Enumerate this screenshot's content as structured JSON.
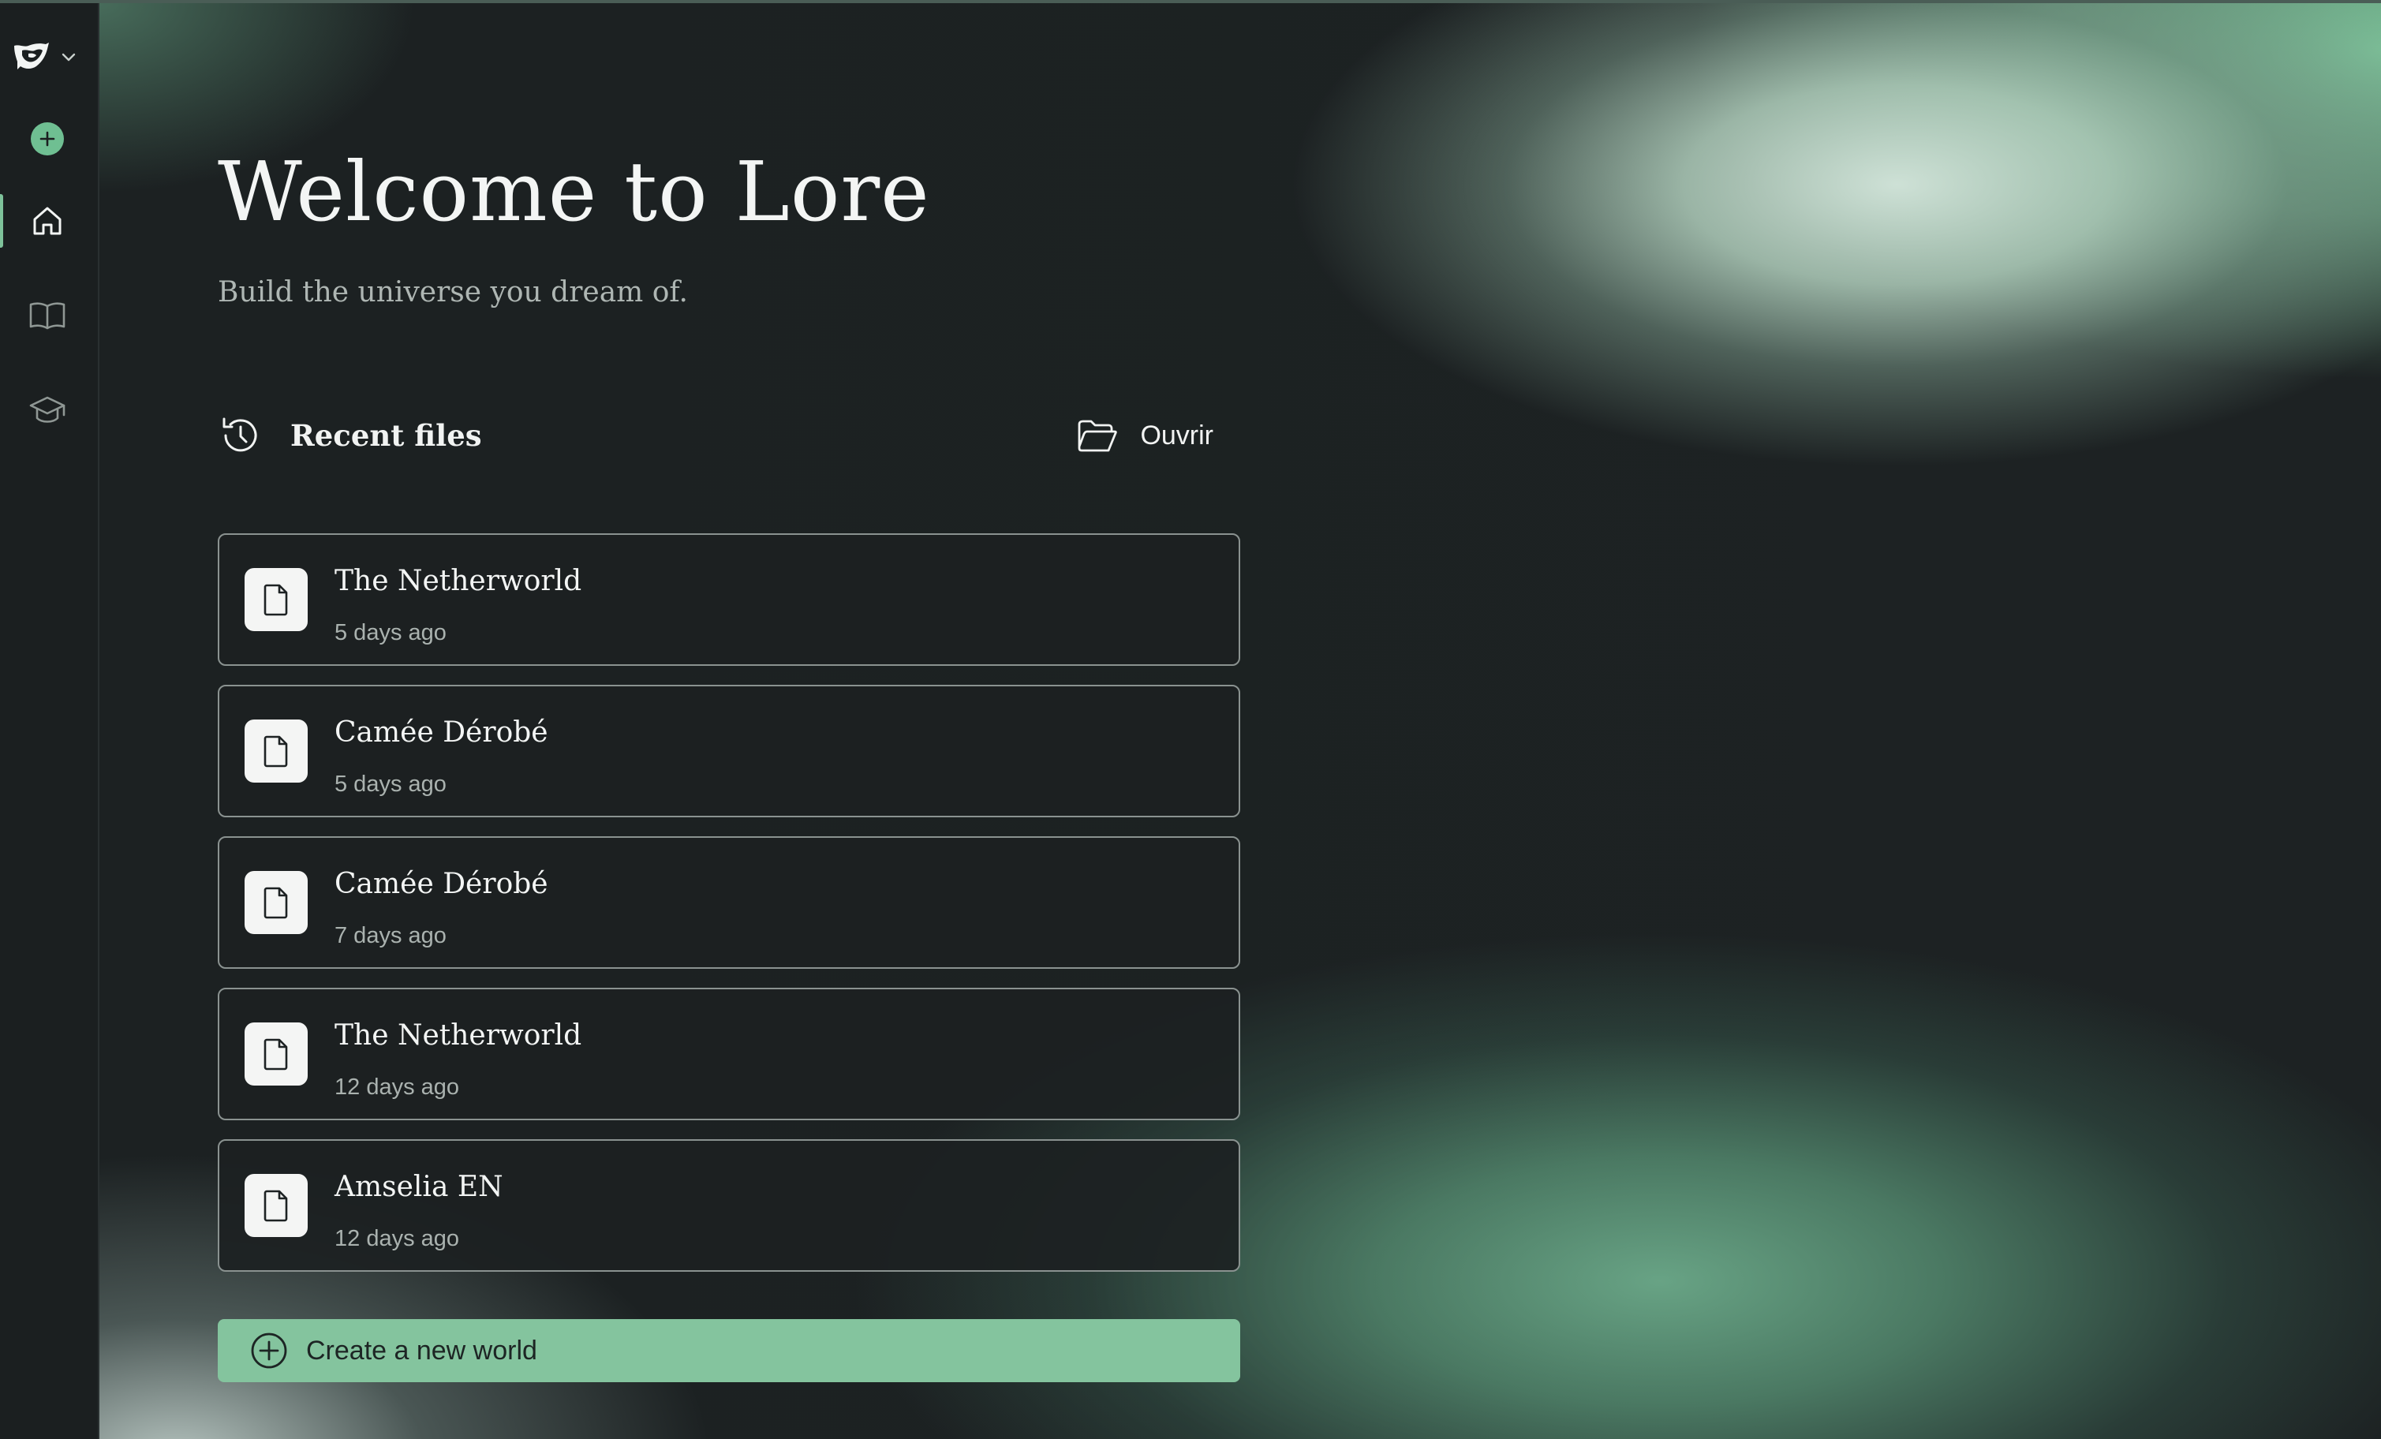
{
  "app": {
    "brand_color": "#84c49e",
    "background_color": "#1d2223"
  },
  "sidebar": {
    "items": [
      {
        "name": "new-item",
        "icon": "plus-circle-icon"
      },
      {
        "name": "home",
        "icon": "home-icon",
        "active": true
      },
      {
        "name": "library",
        "icon": "book-icon"
      },
      {
        "name": "learn",
        "icon": "graduation-cap-icon"
      }
    ]
  },
  "header": {
    "title": "Welcome to Lore",
    "subtitle": "Build the universe you dream of."
  },
  "recent": {
    "title": "Recent files",
    "open_label": "Ouvrir",
    "files": [
      {
        "name": "The Netherworld",
        "time": "5 days ago"
      },
      {
        "name": "Camée Dérobé",
        "time": "5 days ago"
      },
      {
        "name": "Camée Dérobé",
        "time": "7 days ago"
      },
      {
        "name": "The Netherworld",
        "time": "12 days ago"
      },
      {
        "name": "Amselia EN",
        "time": "12 days ago"
      }
    ]
  },
  "create": {
    "label": "Create a new world"
  }
}
